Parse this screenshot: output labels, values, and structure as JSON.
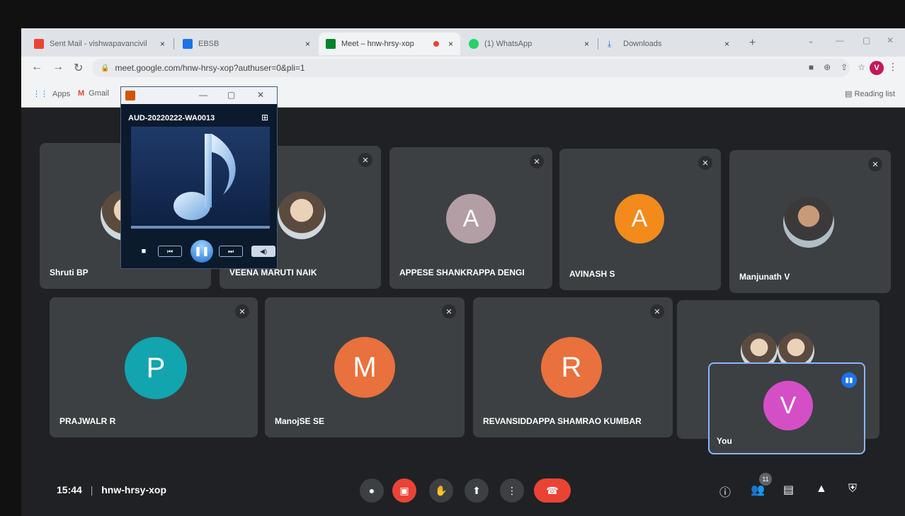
{
  "browser": {
    "tabs": [
      {
        "label": "Sent Mail - vishwapavancivil",
        "color": "#ea4335"
      },
      {
        "label": "EBSB",
        "color": "#1a73e8"
      },
      {
        "label": "Meet – hnw-hrsy-xop",
        "color": "#00832d"
      },
      {
        "label": "(1) WhatsApp",
        "color": "#25d366"
      },
      {
        "label": "Downloads",
        "color": "#1a73e8"
      }
    ],
    "close_glyph": "×",
    "new_tab_glyph": "+",
    "url": "meet.google.com/hnw-hrsy-xop?authuser=0&pli=1",
    "profile_initial": "V",
    "bookmarks": [
      {
        "label": "Apps"
      },
      {
        "label": "Gmail"
      }
    ],
    "reading_list": "Reading list"
  },
  "player": {
    "track_title": "AUD-20220222-WA0013",
    "progress": 0.0
  },
  "participants": [
    {
      "name": "Shruti BP",
      "muted": false
    },
    {
      "name": "VEENA MARUTI NAIK",
      "muted": true
    },
    {
      "name": "APPESE SHANKRAPPA DENGI",
      "muted": true,
      "initial": "A",
      "color": "#b39ea6"
    },
    {
      "name": "AVINASH S",
      "muted": true,
      "initial": "A",
      "color": "#f28b1c"
    },
    {
      "name": "Manjunath V",
      "muted": true
    },
    {
      "name": "PRAJWALR R",
      "muted": true,
      "initial": "P",
      "color": "#12a4af"
    },
    {
      "name": "ManojSE SE",
      "muted": true,
      "initial": "M",
      "color": "#e8713d"
    },
    {
      "name": "REVANSIDDAPPA SHAMRAO KUMBAR",
      "muted": true,
      "initial": "R",
      "color": "#e8713d"
    }
  ],
  "self_tile": {
    "name": "You",
    "initial": "V",
    "color": "#d44fc6"
  },
  "meeting": {
    "time": "15:44",
    "separator": "|",
    "code": "hnw-hrsy-xop",
    "participant_count": "11"
  }
}
